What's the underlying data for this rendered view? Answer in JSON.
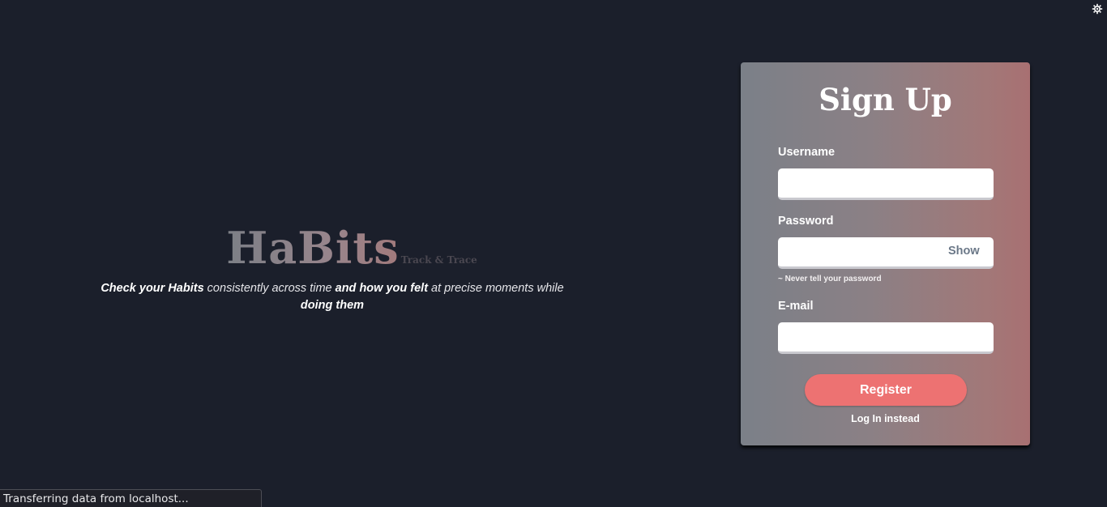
{
  "settings": {
    "icon": "gear-icon"
  },
  "hero": {
    "brand": "HaBits",
    "brand_sub": "Track & Trace",
    "tagline": {
      "part1": "Check your Habits",
      "part2": " consistently across time ",
      "part3": "and how you felt",
      "part4": " at precise moments while ",
      "part5": "doing them"
    }
  },
  "signup": {
    "title": "Sign Up",
    "username_label": "Username",
    "username_value": "",
    "password_label": "Password",
    "password_value": "",
    "show_label": "Show",
    "password_hint": "~ Never tell your password",
    "email_label": "E-mail",
    "email_value": "",
    "register_label": "Register",
    "login_link": "Log In instead"
  },
  "status": {
    "text": "Transferring data from localhost..."
  },
  "colors": {
    "background": "#1b1f2b",
    "register": "#ed7272",
    "card_left": "#7b8088",
    "card_right": "#a87072"
  }
}
